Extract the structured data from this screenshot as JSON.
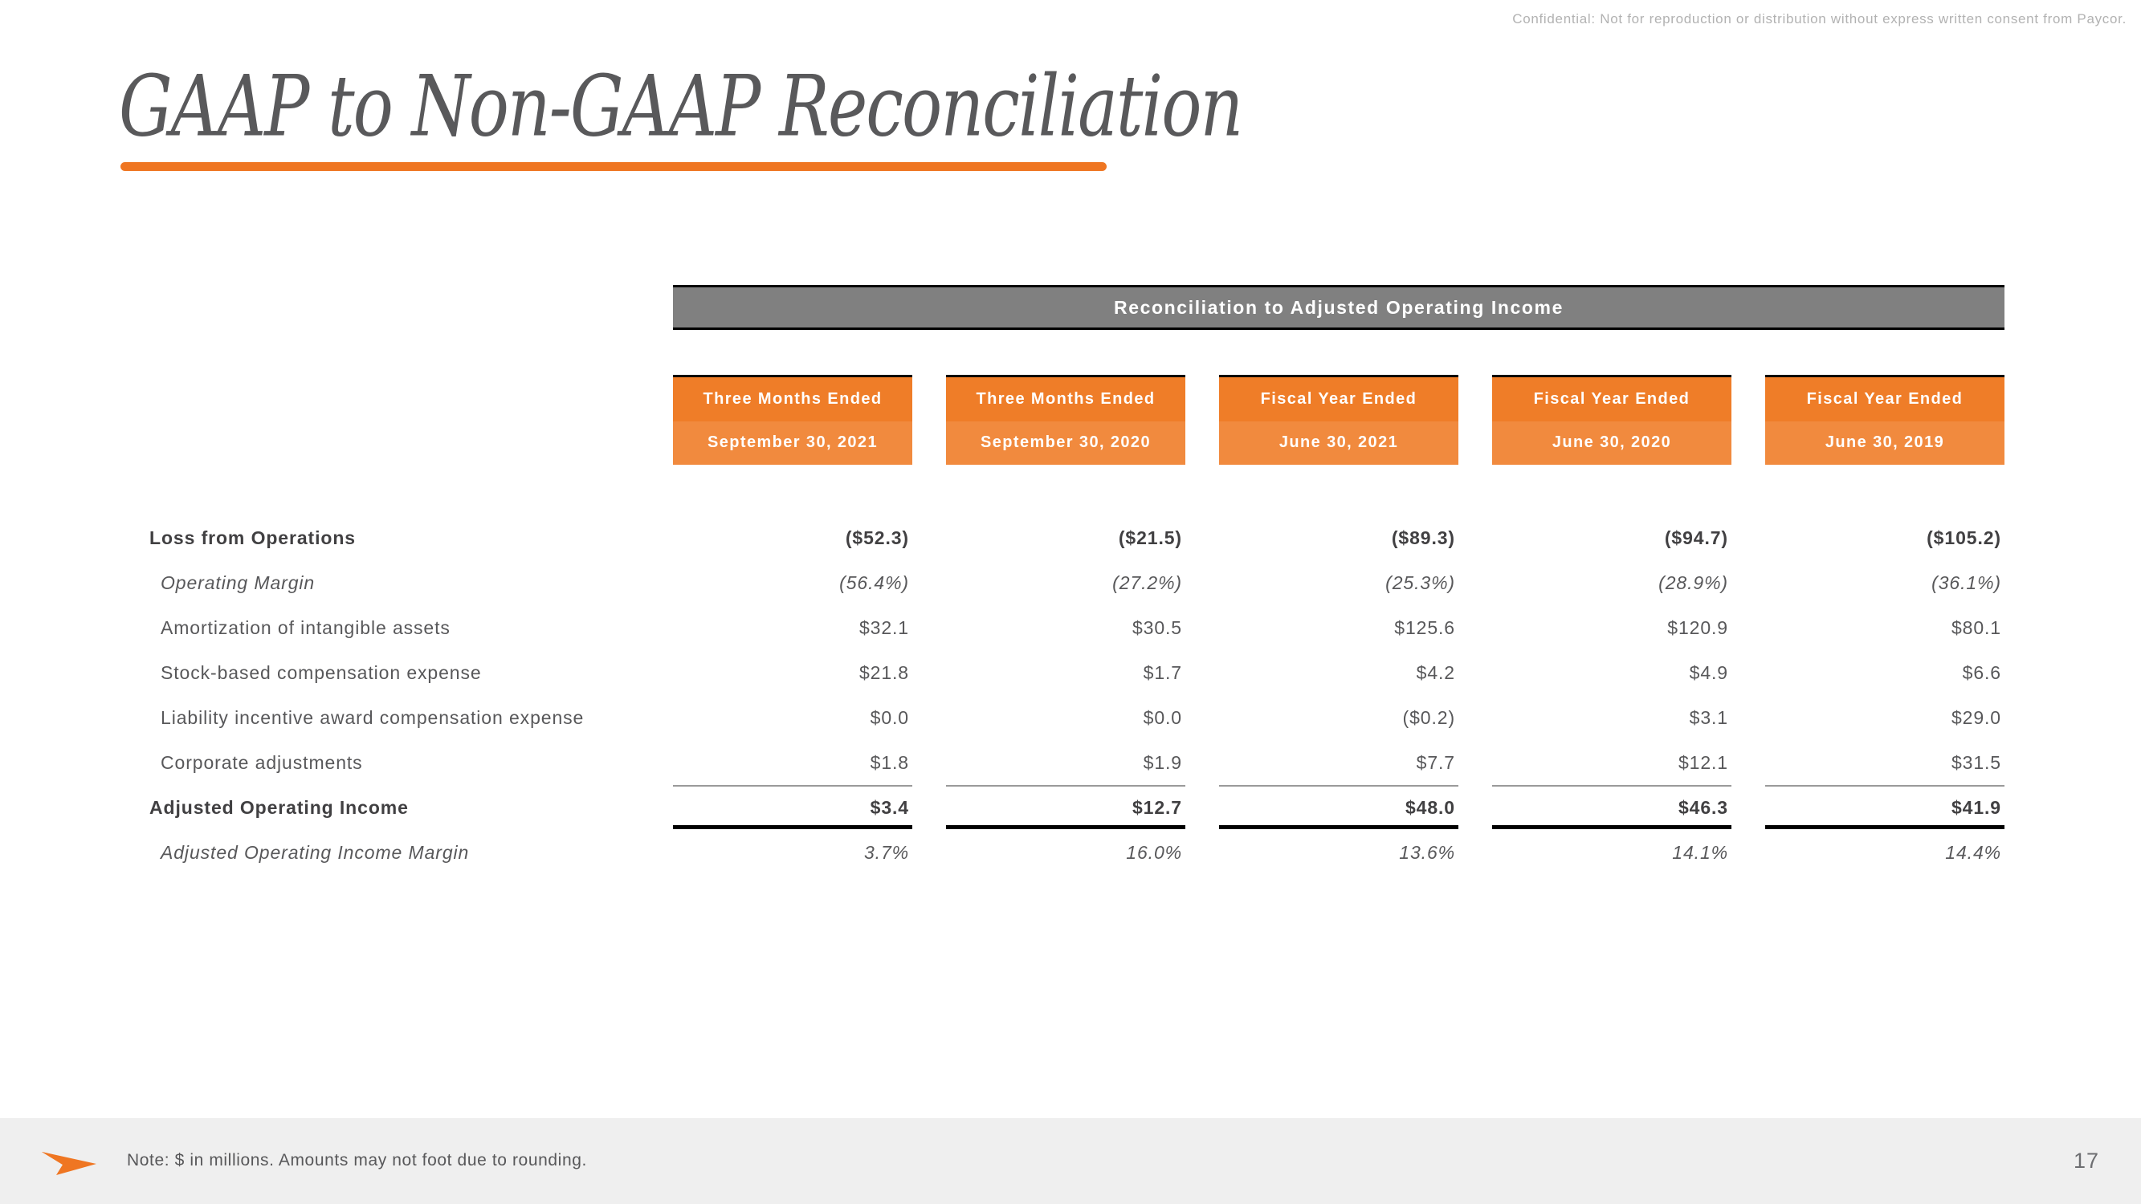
{
  "header": {
    "confidential_notice": "Confidential: Not for reproduction or distribution without express written consent from Paycor."
  },
  "title": {
    "text": "GAAP to Non-GAAP Reconciliation"
  },
  "table": {
    "section_header": "Reconciliation to Adjusted Operating Income",
    "columns": [
      {
        "line1": "Three Months Ended",
        "line2": "September 30, 2021"
      },
      {
        "line1": "Three Months Ended",
        "line2": "September 30, 2020"
      },
      {
        "line1": "Fiscal Year Ended",
        "line2": "June 30, 2021"
      },
      {
        "line1": "Fiscal Year Ended",
        "line2": "June 30, 2020"
      },
      {
        "line1": "Fiscal Year Ended",
        "line2": "June 30, 2019"
      }
    ],
    "rows": [
      {
        "label": "Loss from Operations",
        "style": "bold",
        "indent": 0,
        "values": [
          "($52.3)",
          "($21.5)",
          "($89.3)",
          "($94.7)",
          "($105.2)"
        ]
      },
      {
        "label": "Operating Margin",
        "style": "italic",
        "indent": 1,
        "values": [
          "(56.4%)",
          "(27.2%)",
          "(25.3%)",
          "(28.9%)",
          "(36.1%)"
        ]
      },
      {
        "label": "Amortization of intangible assets",
        "style": "normal",
        "indent": 1,
        "values": [
          "$32.1",
          "$30.5",
          "$125.6",
          "$120.9",
          "$80.1"
        ]
      },
      {
        "label": "Stock-based compensation expense",
        "style": "normal",
        "indent": 1,
        "values": [
          "$21.8",
          "$1.7",
          "$4.2",
          "$4.9",
          "$6.6"
        ]
      },
      {
        "label": "Liability incentive award compensation expense",
        "style": "normal",
        "indent": 1,
        "values": [
          "$0.0",
          "$0.0",
          "($0.2)",
          "$3.1",
          "$29.0"
        ]
      },
      {
        "label": "Corporate adjustments",
        "style": "normal",
        "indent": 1,
        "values": [
          "$1.8",
          "$1.9",
          "$7.7",
          "$12.1",
          "$31.5"
        ]
      },
      {
        "label": "Adjusted Operating Income",
        "style": "bold",
        "indent": 0,
        "rule": "total",
        "values": [
          "$3.4",
          "$12.7",
          "$48.0",
          "$46.3",
          "$41.9"
        ]
      },
      {
        "label": "Adjusted Operating Income Margin",
        "style": "italic",
        "indent": 1,
        "values": [
          "3.7%",
          "16.0%",
          "13.6%",
          "14.1%",
          "14.4%"
        ]
      }
    ]
  },
  "footer": {
    "note": "Note: $ in millions. Amounts may not foot due to rounding.",
    "page_number": "17",
    "logo_name": "paycor-arrow-logo"
  },
  "colors": {
    "accent_orange": "#ef7622",
    "header_orange": "#ef7d28",
    "header_orange_light": "#f18a3e",
    "section_gray": "#808080",
    "text_gray": "#58585a",
    "footer_bg": "#efefef"
  },
  "chart_data": {
    "type": "table",
    "title": "Reconciliation to Adjusted Operating Income",
    "categories": [
      "Three Months Ended September 30, 2021",
      "Three Months Ended September 30, 2020",
      "Fiscal Year Ended June 30, 2021",
      "Fiscal Year Ended June 30, 2020",
      "Fiscal Year Ended June 30, 2019"
    ],
    "series": [
      {
        "name": "Loss from Operations",
        "values": [
          -52.3,
          -21.5,
          -89.3,
          -94.7,
          -105.2
        ]
      },
      {
        "name": "Operating Margin",
        "values": [
          -56.4,
          -27.2,
          -25.3,
          -28.9,
          -36.1
        ]
      },
      {
        "name": "Amortization of intangible assets",
        "values": [
          32.1,
          30.5,
          125.6,
          120.9,
          80.1
        ]
      },
      {
        "name": "Stock-based compensation expense",
        "values": [
          21.8,
          1.7,
          4.2,
          4.9,
          6.6
        ]
      },
      {
        "name": "Liability incentive award compensation expense",
        "values": [
          0.0,
          0.0,
          -0.2,
          3.1,
          29.0
        ]
      },
      {
        "name": "Corporate adjustments",
        "values": [
          1.8,
          1.9,
          7.7,
          12.1,
          31.5
        ]
      },
      {
        "name": "Adjusted Operating Income",
        "values": [
          3.4,
          12.7,
          48.0,
          46.3,
          41.9
        ]
      },
      {
        "name": "Adjusted Operating Income Margin",
        "values": [
          3.7,
          16.0,
          13.6,
          14.1,
          14.4
        ]
      }
    ],
    "xlabel": "",
    "ylabel": "$ in millions"
  }
}
